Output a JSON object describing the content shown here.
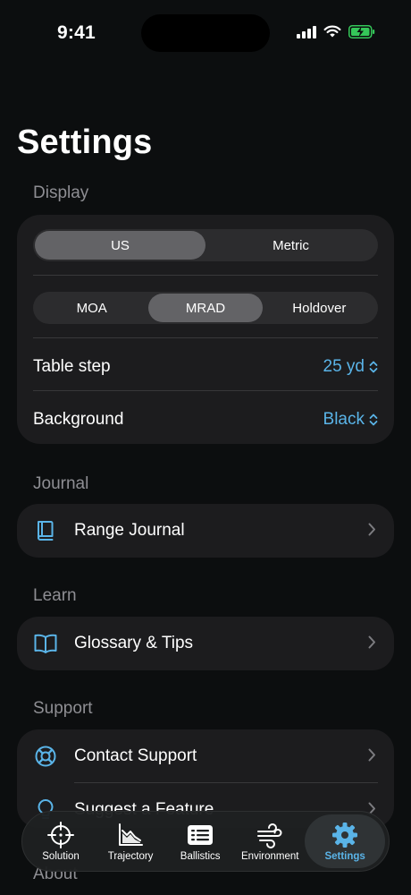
{
  "status_bar": {
    "time": "9:41"
  },
  "page_title": "Settings",
  "display": {
    "label": "Display",
    "units": {
      "options": [
        "US",
        "Metric"
      ],
      "selected": "US"
    },
    "angular": {
      "options": [
        "MOA",
        "MRAD",
        "Holdover"
      ],
      "selected": "MRAD"
    },
    "table_step": {
      "label": "Table step",
      "value": "25 yd"
    },
    "background": {
      "label": "Background",
      "value": "Black"
    }
  },
  "journal": {
    "label": "Journal",
    "item": {
      "label": "Range Journal",
      "icon": "book-icon"
    }
  },
  "learn": {
    "label": "Learn",
    "item": {
      "label": "Glossary & Tips",
      "icon": "open-book-icon"
    }
  },
  "support": {
    "label": "Support",
    "items": [
      {
        "label": "Contact Support",
        "icon": "lifebuoy-icon"
      },
      {
        "label": "Suggest a Feature",
        "icon": "lightbulb-icon"
      }
    ]
  },
  "about": {
    "label": "About"
  },
  "tabs": [
    {
      "label": "Solution",
      "icon": "crosshair-icon"
    },
    {
      "label": "Trajectory",
      "icon": "trajectory-chart-icon"
    },
    {
      "label": "Ballistics",
      "icon": "table-card-icon"
    },
    {
      "label": "Environment",
      "icon": "wind-icon"
    },
    {
      "label": "Settings",
      "icon": "gear-icon",
      "active": true
    }
  ],
  "colors": {
    "accent": "#5ab4e8",
    "background": "#0c0e0f",
    "card": "#1c1c1e",
    "battery": "#35c759"
  }
}
